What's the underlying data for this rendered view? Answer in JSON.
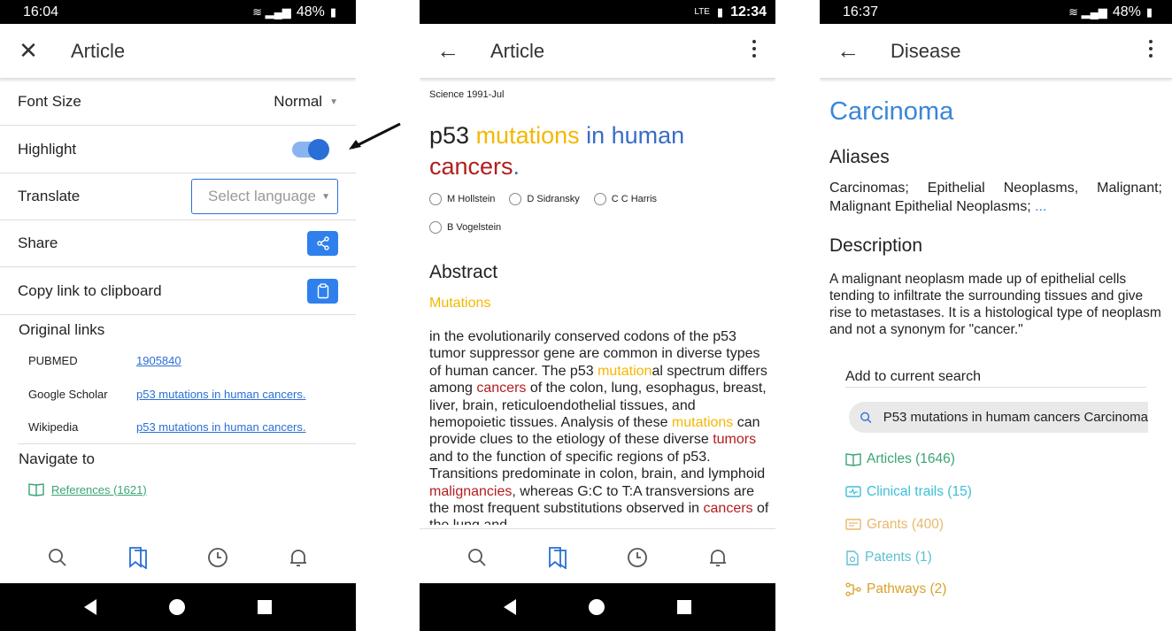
{
  "panel1": {
    "status": {
      "time": "16:04",
      "battery": "48%"
    },
    "appbar": {
      "title": "Article"
    },
    "font_size": {
      "label": "Font Size",
      "value": "Normal"
    },
    "highlight": {
      "label": "Highlight",
      "on": true
    },
    "translate": {
      "label": "Translate",
      "placeholder": "Select language"
    },
    "share": {
      "label": "Share"
    },
    "copy": {
      "label": "Copy link to clipboard"
    },
    "original_links": {
      "heading": "Original links",
      "items": [
        {
          "key": "PUBMED",
          "value": "1905840"
        },
        {
          "key": "Google Scholar",
          "value": "p53 mutations in human cancers."
        },
        {
          "key": "Wikipedia",
          "value": "p53 mutations in human cancers."
        }
      ]
    },
    "navigate": {
      "heading": "Navigate to",
      "link": "References (1621)"
    }
  },
  "panel2": {
    "status": {
      "time": "12:34",
      "network": "LTE"
    },
    "appbar": {
      "title": "Article"
    },
    "journal": "Science 1991-Jul",
    "title_parts": [
      "p53 ",
      "mutations",
      " in human ",
      "cancers",
      "."
    ],
    "authors": [
      "M Hollstein",
      "D Sidransky",
      "C C Harris",
      "B Vogelstein"
    ],
    "abstract_heading": "Abstract",
    "abstract_sub": "Mutations",
    "abstract_parts": [
      "in the evolutionarily conserved codons of the p53 tumor suppressor gene are common in diverse types of human cancer. The p53 ",
      "mutation",
      "al spectrum differs among ",
      "cancers",
      " of the colon, lung, esophagus, breast, liver, brain, reticuloendothelial tissues, and hemopoietic tissues. Analysis of these ",
      "mutations",
      " can provide clues to the etiology of these diverse ",
      "tumors",
      " and to the function of specific regions of p53. Transitions predominate in colon, brain, and lymphoid ",
      "malignancies",
      ", whereas G:C to T:A transversions are the most frequent substitutions observed in ",
      "cancers",
      " of the lung and"
    ]
  },
  "panel3": {
    "status": {
      "time": "16:37",
      "battery": "48%"
    },
    "appbar": {
      "title": "Disease"
    },
    "name": "Carcinoma",
    "aliases_heading": "Aliases",
    "aliases": "Carcinomas; Epithelial Neoplasms, Malignant; Malignant Epithelial Neoplasms;",
    "aliases_more": "...",
    "description_heading": "Description",
    "description": "A malignant neoplasm made up of epithelial cells tending to infiltrate the surrounding tissues and give rise to metastases. It is a histological type of neoplasm and not a synonym for \"cancer.\"",
    "add_heading": "Add to current search",
    "search_value": "P53 mutations in humam cancers Carcinoma",
    "categories": [
      {
        "label": "Articles (1646)",
        "icon": "book-icon",
        "color": "#3aa574"
      },
      {
        "label": "Clinical trails (15)",
        "icon": "trial-icon",
        "color": "#3cbfd8"
      },
      {
        "label": "Grants (400)",
        "icon": "grant-icon",
        "color": "#e8b86a"
      },
      {
        "label": "Patents (1)",
        "icon": "patent-icon",
        "color": "#5fc0cf"
      },
      {
        "label": "Pathways (2)",
        "icon": "pathway-icon",
        "color": "#d9a22c"
      }
    ]
  },
  "colors": {
    "accent": "#2a6fd6",
    "highlight_yellow": "#f5b700",
    "highlight_blue": "#3a6cc7",
    "highlight_red": "#b21e1e",
    "disease_title": "#3a86d8"
  }
}
